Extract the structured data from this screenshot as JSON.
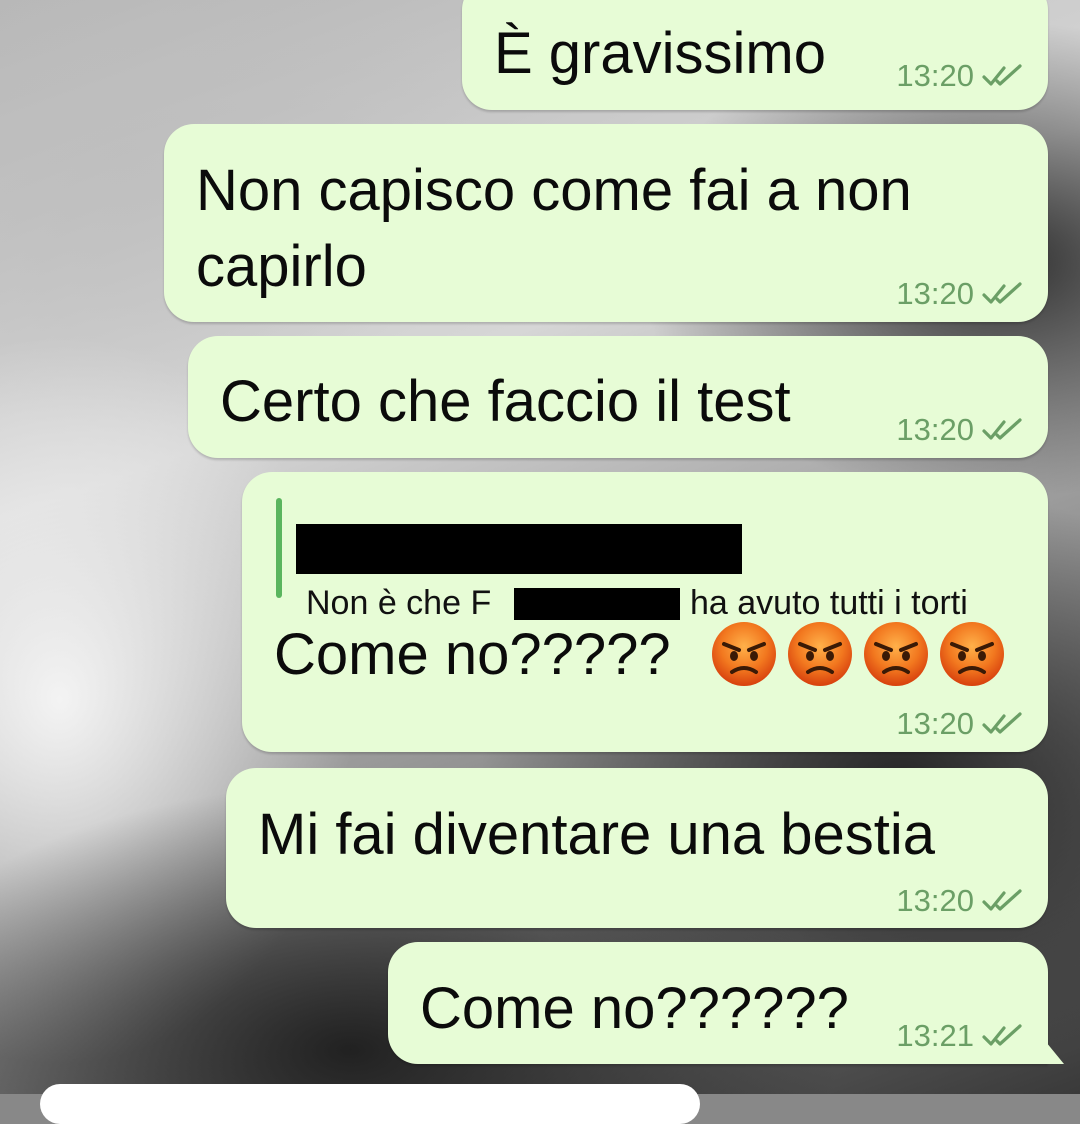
{
  "messages": [
    {
      "text": "È gravissimo",
      "time": "13:20"
    },
    {
      "line1": "Non capisco come fai a non",
      "line2": "capirlo",
      "time": "13:20"
    },
    {
      "text": "Certo che faccio il test",
      "time": "13:20"
    },
    {
      "quote": {
        "before": "Non è che F",
        "after": "ha avuto tutti i torti"
      },
      "text": "Come no?????",
      "time": "13:20",
      "emoji_icon": "angry-face-emoji",
      "emoji_count": 4
    },
    {
      "text": "Mi fai diventare una bestia",
      "time": "13:20"
    },
    {
      "text": "Come no??????",
      "time": "13:21"
    }
  ],
  "colors": {
    "bubble": "#e7fcd6",
    "time_text": "#6b9f66",
    "read_ticks": "#6b9f66",
    "quote_bar": "#5ab55e"
  },
  "icons": {
    "read_receipt": "double-check-icon",
    "emoji": "angry-face-emoji"
  }
}
